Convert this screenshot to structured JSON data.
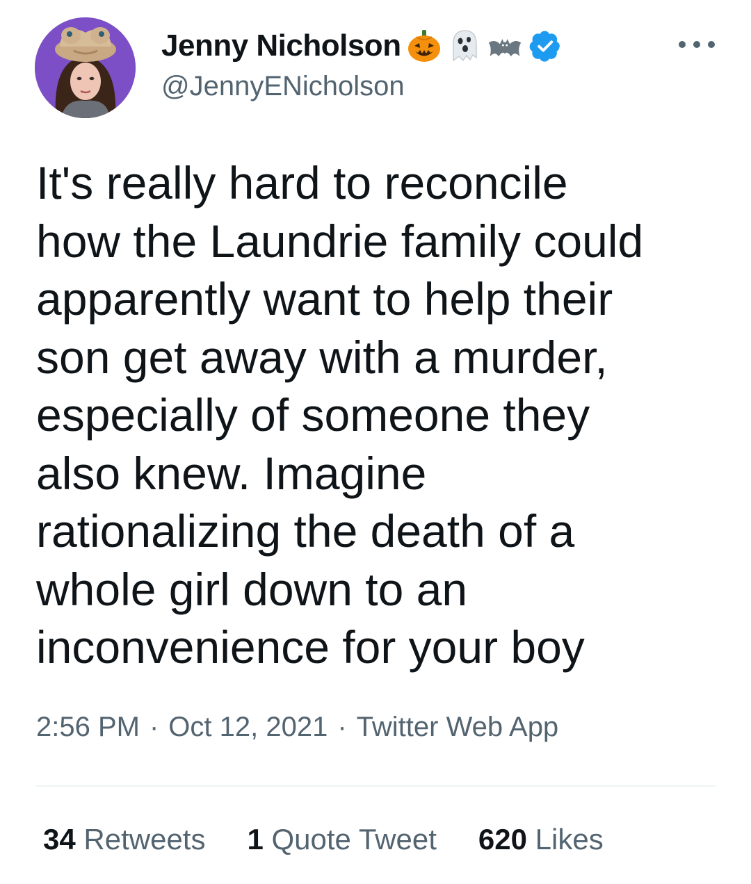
{
  "author": {
    "display_name": "Jenny Nicholson",
    "handle": "@JennyENicholson",
    "name_emojis": [
      "jack-o-lantern",
      "ghost",
      "bat"
    ],
    "verified": true
  },
  "tweet": {
    "text_lines": [
      "It's really hard to reconcile",
      "how the Laundrie family could",
      "apparently want to help their",
      "son get away with a murder,",
      "especially of someone they",
      "also knew. Imagine",
      "rationalizing the death of a",
      "whole girl down to an",
      "inconvenience for your boy"
    ],
    "time": "2:56 PM",
    "date": "Oct 12, 2021",
    "source": "Twitter Web App",
    "separator": "·"
  },
  "stats": {
    "retweets": {
      "count": "34",
      "label": "Retweets"
    },
    "quotes": {
      "count": "1",
      "label": "Quote Tweet"
    },
    "likes": {
      "count": "620",
      "label": "Likes"
    }
  },
  "colors": {
    "text": "#0f1419",
    "secondary": "#536471",
    "verified": "#1d9bf0",
    "divider": "#eff3f4",
    "avatar_bg": "#7c4fc6"
  }
}
